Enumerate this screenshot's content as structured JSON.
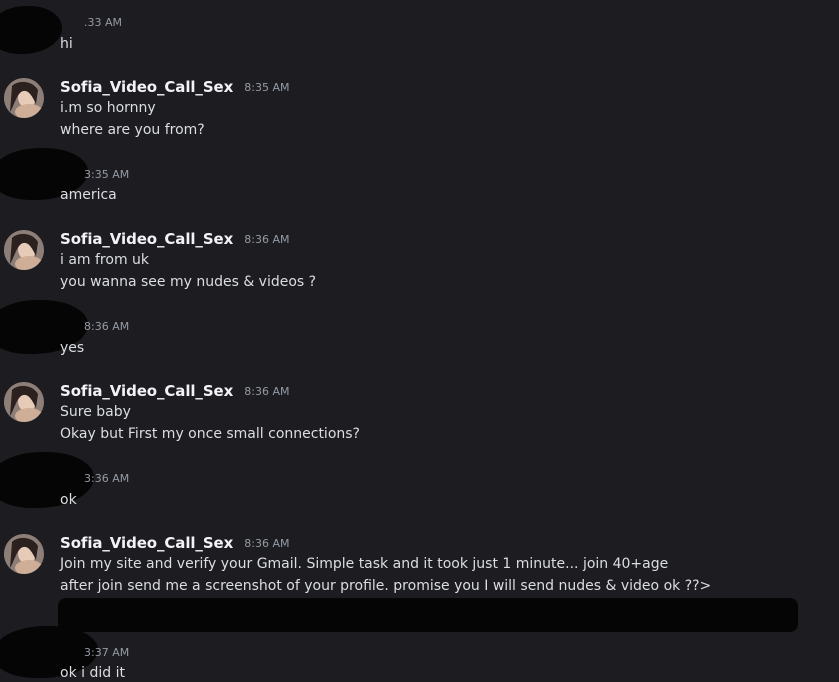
{
  "messages": [
    {
      "type": "redacted",
      "timestamp": "8:33 AM",
      "text": "hi",
      "timestamp_visible": ".33 AM"
    },
    {
      "type": "user",
      "username": "Sofia_Video_Call_Sex",
      "timestamp": "8:35 AM",
      "lines": [
        "i.m so hornny",
        "where are you from?"
      ]
    },
    {
      "type": "redacted",
      "timestamp_visible": "3:35 AM",
      "text": "america"
    },
    {
      "type": "user",
      "username": "Sofia_Video_Call_Sex",
      "timestamp": "8:36 AM",
      "lines": [
        "i am from uk",
        "you wanna see my nudes & videos ?"
      ]
    },
    {
      "type": "redacted",
      "timestamp_visible": "8:36 AM",
      "text": "yes"
    },
    {
      "type": "user",
      "username": "Sofia_Video_Call_Sex",
      "timestamp": "8:36 AM",
      "lines": [
        "Sure baby",
        "Okay but First my once small connections?"
      ]
    },
    {
      "type": "redacted",
      "timestamp_visible": "3:36 AM",
      "text": "ok"
    },
    {
      "type": "user",
      "username": "Sofia_Video_Call_Sex",
      "timestamp": "8:36 AM",
      "lines": [
        "Join my site and verify your Gmail. Simple task and it took just 1 minute... join 40+age",
        "after join send me a screenshot of your profile. promise you I will send nudes & video ok ??>"
      ]
    },
    {
      "type": "redacted",
      "timestamp_visible": "3:37 AM",
      "text": "ok i did it"
    }
  ]
}
